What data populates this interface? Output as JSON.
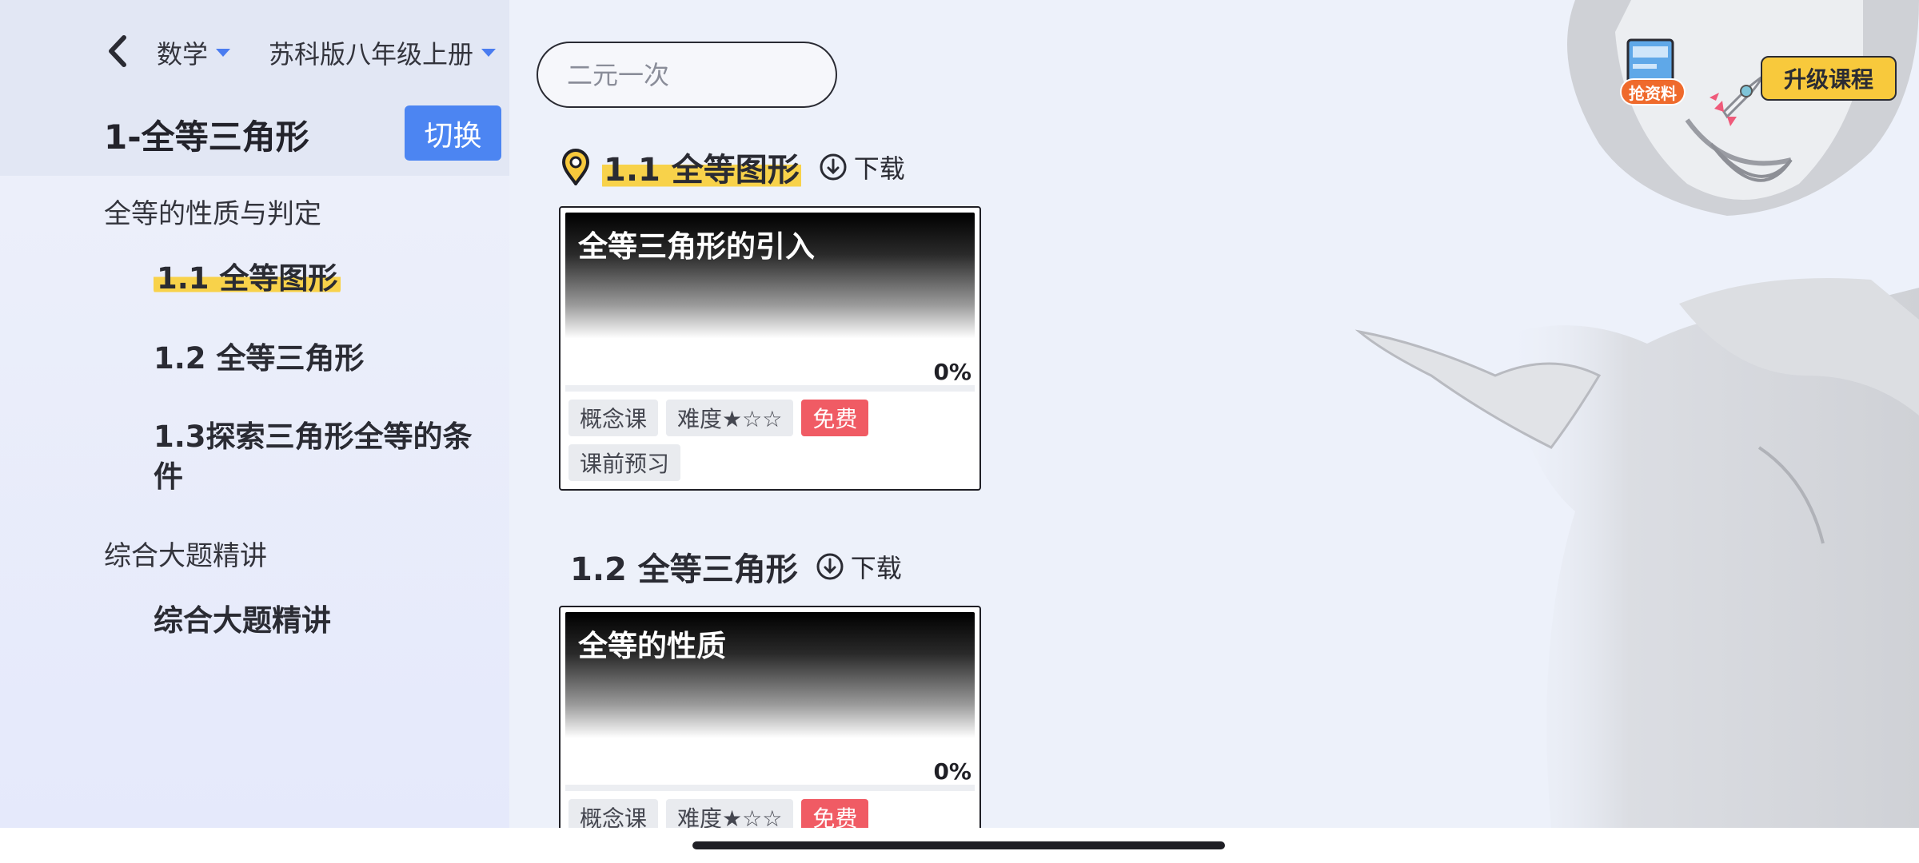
{
  "header": {
    "subject": "数学",
    "textbook": "苏科版八年级上册",
    "unit_title": "1-全等三角形",
    "switch_label": "切换"
  },
  "sidebar": {
    "sections": [
      {
        "label": "全等的性质与判定",
        "items": [
          {
            "label": "1.1 全等图形",
            "active": true
          },
          {
            "label": "1.2 全等三角形",
            "active": false
          },
          {
            "label": "1.3探索三角形全等的条件",
            "active": false
          }
        ]
      },
      {
        "label": "综合大题精讲",
        "items": [
          {
            "label": "综合大题精讲",
            "active": false
          }
        ]
      }
    ]
  },
  "search": {
    "placeholder": "二元一次",
    "value": ""
  },
  "lessons": [
    {
      "heading": "1.1 全等图形",
      "download_label": "下载",
      "card": {
        "title": "全等三角形的引入",
        "progress": "0%",
        "tags": [
          "概念课",
          "难度★☆☆",
          "免费",
          "课前预习"
        ]
      }
    },
    {
      "heading": "1.2 全等三角形",
      "download_label": "下载",
      "card": {
        "title": "全等的性质",
        "progress": "0%",
        "tags": [
          "概念课",
          "难度★☆☆",
          "免费"
        ]
      }
    }
  ],
  "promo": {
    "materials_label": "抢资料",
    "upgrade_label": "升级课程"
  },
  "colors": {
    "accent": "#4c85f2",
    "highlight": "#f8d24a",
    "free_tag": "#f05b64",
    "upgrade": "#f8c93c",
    "promo": "#ef6a2c"
  }
}
